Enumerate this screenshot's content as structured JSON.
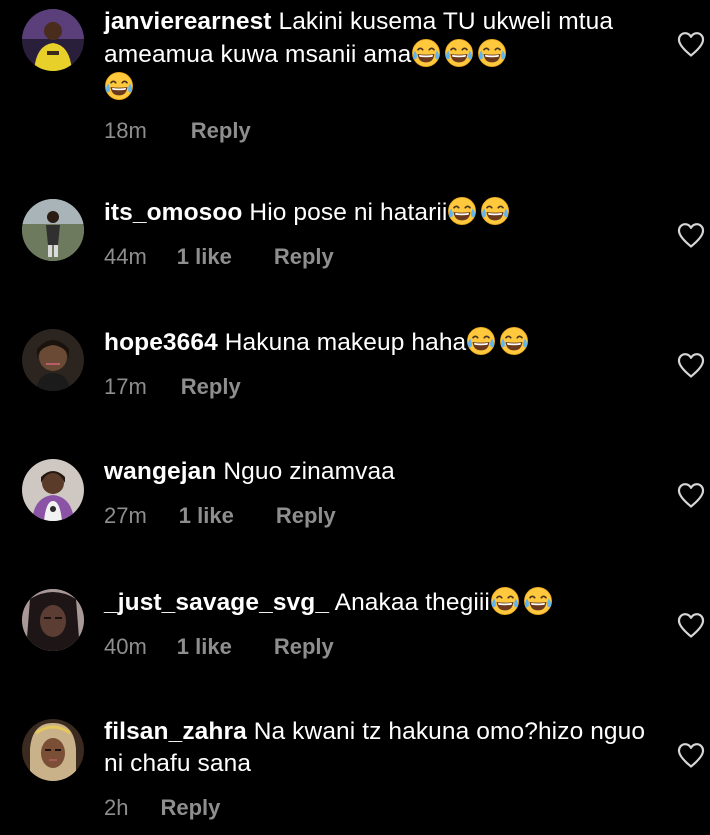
{
  "colors": {
    "background": "#000000",
    "text": "#ffffff",
    "secondary": "#8e8e8e"
  },
  "comments": [
    {
      "username": "janvierearnest",
      "text": "Lakini kusema TU ukweli mtua ameamua kuwa msanii ama",
      "emoji": "face-with-tears-of-joy x4",
      "time": "18m",
      "likes": "",
      "reply": "Reply",
      "like_icon": "heart-outline-icon"
    },
    {
      "username": "its_omosoo",
      "text": "Hio pose ni hatarii",
      "emoji": "face-with-tears-of-joy x2",
      "time": "44m",
      "likes": "1 like",
      "reply": "Reply",
      "like_icon": "heart-outline-icon"
    },
    {
      "username": "hope3664",
      "text": "Hakuna makeup haha",
      "emoji": "face-with-tears-of-joy x2",
      "time": "17m",
      "likes": "",
      "reply": "Reply",
      "like_icon": "heart-outline-icon"
    },
    {
      "username": "wangejan",
      "text": "Nguo zinamvaa",
      "emoji": "",
      "time": "27m",
      "likes": "1 like",
      "reply": "Reply",
      "like_icon": "heart-outline-icon"
    },
    {
      "username": "_just_savage_svg_",
      "text": "Anakaa thegiii",
      "emoji": "face-with-tears-of-joy x2",
      "time": "40m",
      "likes": "1 like",
      "reply": "Reply",
      "like_icon": "heart-outline-icon"
    },
    {
      "username": "filsan_zahra",
      "text": "Na kwani tz hakuna omo?hizo nguo ni chafu sana",
      "emoji": "",
      "time": "2h",
      "likes": "",
      "reply": "Reply",
      "like_icon": "heart-outline-icon"
    }
  ]
}
